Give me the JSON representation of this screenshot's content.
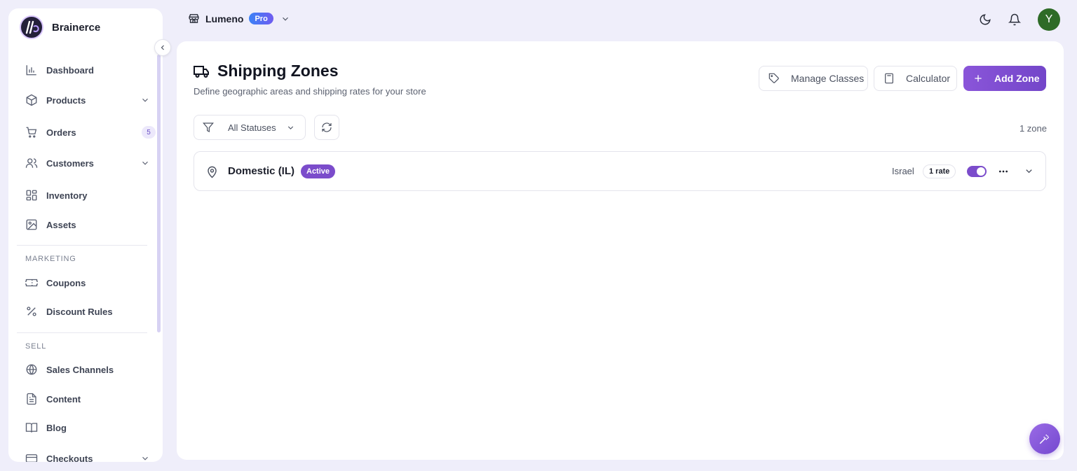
{
  "brand": {
    "name": "Brainerce"
  },
  "store": {
    "name": "Lumeno",
    "plan_badge": "Pro"
  },
  "sidebar": {
    "items": [
      {
        "label": "Dashboard",
        "icon": "bar-chart-icon"
      },
      {
        "label": "Products",
        "icon": "box-icon"
      },
      {
        "label": "Orders",
        "icon": "cart-icon",
        "count": "5"
      },
      {
        "label": "Customers",
        "icon": "users-icon"
      },
      {
        "label": "Inventory",
        "icon": "grid-icon"
      },
      {
        "label": "Assets",
        "icon": "image-icon"
      }
    ],
    "marketing_title": "MARKETING",
    "marketing": [
      {
        "label": "Coupons",
        "icon": "ticket-icon"
      },
      {
        "label": "Discount Rules",
        "icon": "percent-icon"
      }
    ],
    "sell_title": "SELL",
    "sell": [
      {
        "label": "Sales Channels",
        "icon": "globe-icon"
      },
      {
        "label": "Content",
        "icon": "file-text-icon"
      },
      {
        "label": "Blog",
        "icon": "book-open-icon"
      },
      {
        "label": "Checkouts",
        "icon": "credit-card-icon"
      }
    ]
  },
  "page": {
    "title": "Shipping Zones",
    "subtitle": "Define geographic areas and shipping rates for your store",
    "manage_classes": "Manage Classes",
    "calculator": "Calculator",
    "add_zone": "Add Zone",
    "filter_label": "All Statuses",
    "zone_count": "1 zone"
  },
  "zones": [
    {
      "name": "Domestic (IL)",
      "status": "Active",
      "country": "Israel",
      "rates": "1 rate",
      "enabled": true
    }
  ],
  "avatar_initial": "Y",
  "colors": {
    "accent": "#7b4ccb",
    "background": "#efeefa",
    "active_badge": "#7b4ccb"
  }
}
